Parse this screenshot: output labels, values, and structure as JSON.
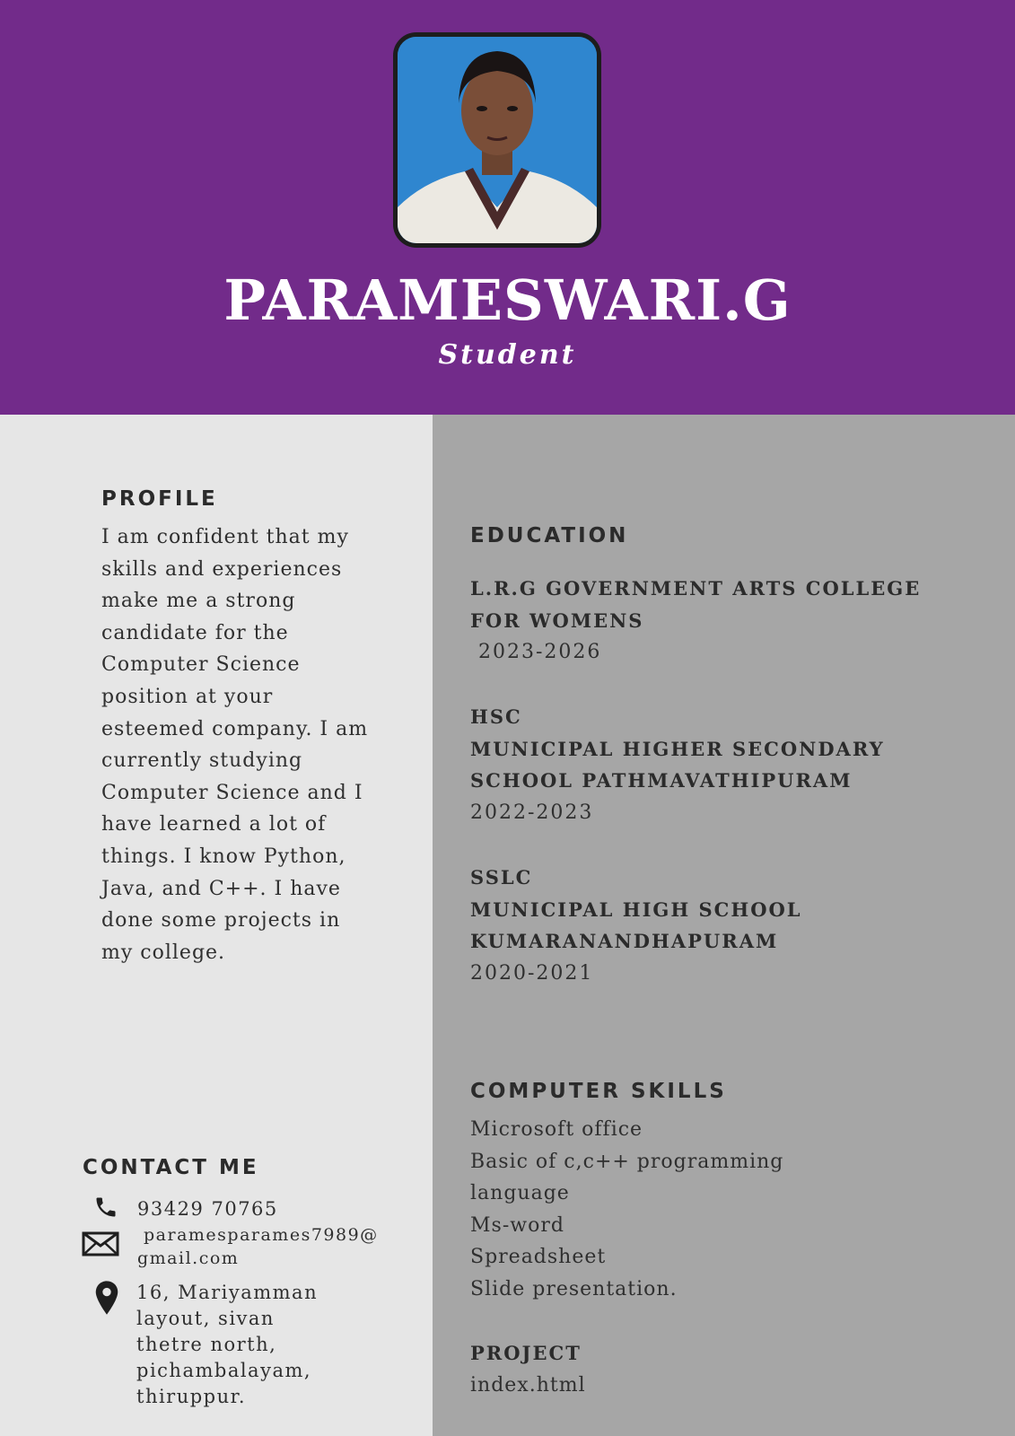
{
  "header": {
    "name": "PARAMESWARI.G",
    "role": "Student",
    "background_color": "#722b8a"
  },
  "profile": {
    "heading": "PROFILE",
    "lines": [
      "I am confident that my",
      "skills and experiences",
      "make me a strong",
      "candidate for the",
      "Computer Science",
      "position at your",
      "esteemed company. I am",
      "currently studying",
      "Computer Science and I",
      "have learned a lot of",
      "things. I know Python,",
      "Java, and C++. I have",
      "done some projects in",
      "my college."
    ]
  },
  "contact": {
    "heading": "CONTACT ME",
    "phone": "93429 70765",
    "email_line1": "paramesparames7989@",
    "email_line2": "gmail.com",
    "address_lines": [
      "16, Mariyamman",
      "layout, sivan",
      "thetre north,",
      "pichambalayam,",
      "thiruppur."
    ],
    "icons": [
      "phone-icon",
      "mail-icon",
      "location-pin-icon"
    ]
  },
  "education": {
    "heading": "EDUCATION",
    "entries": [
      {
        "title_lines": [
          "L.R.G GOVERNMENT ARTS COLLEGE",
          "FOR WOMENS"
        ],
        "years": " 2023-2026"
      },
      {
        "title_lines": [
          "HSC",
          "MUNICIPAL HIGHER SECONDARY",
          "SCHOOL PATHMAVATHIPURAM"
        ],
        "years": "2022-2023"
      },
      {
        "title_lines": [
          "SSLC",
          "MUNICIPAL HIGH SCHOOL",
          "KUMARANANDHAPURAM"
        ],
        "years": "2020-2021"
      }
    ]
  },
  "skills": {
    "heading": "COMPUTER SKILLS",
    "lines": [
      "Microsoft office",
      "Basic of c,c++ programming",
      "language",
      "Ms-word",
      "Spreadsheet",
      "Slide presentation."
    ]
  },
  "project": {
    "heading": "PROJECT",
    "value": "index.html"
  },
  "colors": {
    "left_panel": "#e6e6e6",
    "right_panel": "#a6a6a6",
    "text": "#2b2b2b"
  }
}
